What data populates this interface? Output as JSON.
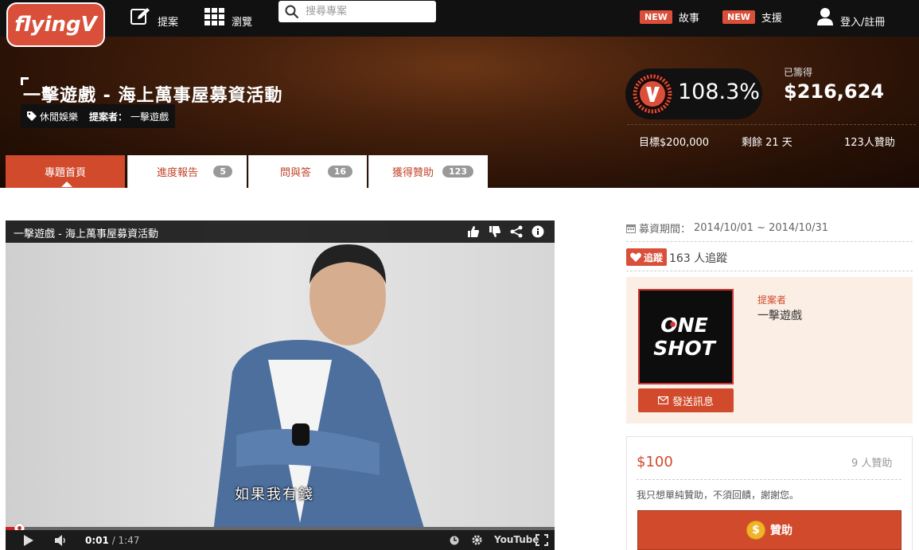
{
  "brand": {
    "logo_text": "flyingV"
  },
  "nav": {
    "propose_label": "提案",
    "browse_label": "瀏覽",
    "search_placeholder": "搜尋專案",
    "stories": {
      "badge": "NEW",
      "label": "故事"
    },
    "support": {
      "badge": "NEW",
      "label": "支援"
    },
    "login_label": "登入/註冊"
  },
  "project": {
    "title": "一擊遊戲 - 海上萬事屋募資活動",
    "category": "休閒娛樂",
    "proposer_label": "提案者：",
    "proposer_name": "一擊遊戲",
    "percent": "108.3%",
    "raised_label": "已籌得",
    "raised_amount": "$216,624",
    "goal_text": "目標$200,000",
    "remaining_text": "剩餘 21 天",
    "backers_text": "123人贊助"
  },
  "tabs": [
    {
      "label": "專題首頁",
      "count": ""
    },
    {
      "label": "進度報告",
      "count": "5"
    },
    {
      "label": "問與答",
      "count": "16"
    },
    {
      "label": "獲得贊助",
      "count": "123"
    }
  ],
  "video": {
    "title": "一擊遊戲 - 海上萬事屋募資活動",
    "subtitle": "如果我有錢",
    "current_time": "0:01",
    "duration": "/ 1:47",
    "brand": "YouTube",
    "progress": 0.01
  },
  "sidebar": {
    "period_label": "募資期間：",
    "period_value": "2014/10/01 ~ 2014/10/31",
    "follow_label": "追蹤",
    "follow_count": "163 人追蹤",
    "owner_label": "提案者",
    "owner_name": "一擊遊戲",
    "owner_avatar_text": [
      "ONE",
      "SHOT"
    ],
    "send_message_label": "發送訊息",
    "reward": {
      "price": "$100",
      "backers": "9 人贊助",
      "description": "我只想單純贊助，不須回饋，謝謝您。",
      "button_label": "贊助"
    }
  },
  "colors": {
    "accent": "#d14a2c",
    "badge_red": "#d94f3a",
    "topbar": "#111111",
    "owner_box_bg": "#fbeee4"
  }
}
